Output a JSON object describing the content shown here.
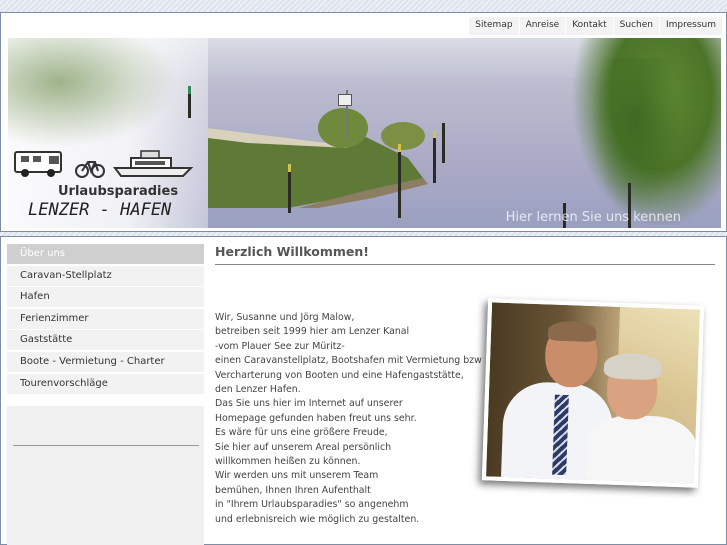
{
  "topnav": {
    "items": [
      "Sitemap",
      "Anreise",
      "Kontakt",
      "Suchen",
      "Impressum"
    ]
  },
  "banner": {
    "brand_line1": "Urlaubsparadies",
    "brand_line2": "LENZER - HAFEN",
    "caption": "Hier lernen Sie uns kennen",
    "icons": [
      "camper-van-icon",
      "bicycle-icon",
      "boat-icon"
    ]
  },
  "sidebar": {
    "items": [
      {
        "label": "Über uns",
        "active": true
      },
      {
        "label": "Caravan-Stellplatz",
        "active": false
      },
      {
        "label": "Hafen",
        "active": false
      },
      {
        "label": "Ferienzimmer",
        "active": false
      },
      {
        "label": "Gaststätte",
        "active": false
      },
      {
        "label": "Boote - Vermietung - Charter",
        "active": false
      },
      {
        "label": "Tourenvorschläge",
        "active": false
      }
    ]
  },
  "main": {
    "title": "Herzlich Willkommen!",
    "body": "Wir, Susanne und Jörg Malow,\nbetreiben seit 1999 hier am Lenzer Kanal\n-vom Plauer See zur Müritz-\neinen Caravanstellplatz, Bootshafen mit Vermietung bzw\nVercharterung von Booten und eine Hafengaststätte,\nden Lenzer Hafen.\nDas Sie uns hier im Internet auf unserer\nHomepage gefunden haben freut uns sehr.\nEs wäre für uns eine größere Freude,\nSie hier auf unserem Areal persönlich\nwillkommen heißen zu können.\nWir werden uns mit unserem Team\nbemühen, Ihnen Ihren Aufenthalt\nin \"Ihrem Urlaubsparadies\" so angenehm\nund erlebnisreich wie möglich zu gestalten."
  },
  "colors": {
    "frame_border": "#7d8ea6",
    "active_menu": "#cfcfcf",
    "page_background": "#dfe6f0"
  }
}
